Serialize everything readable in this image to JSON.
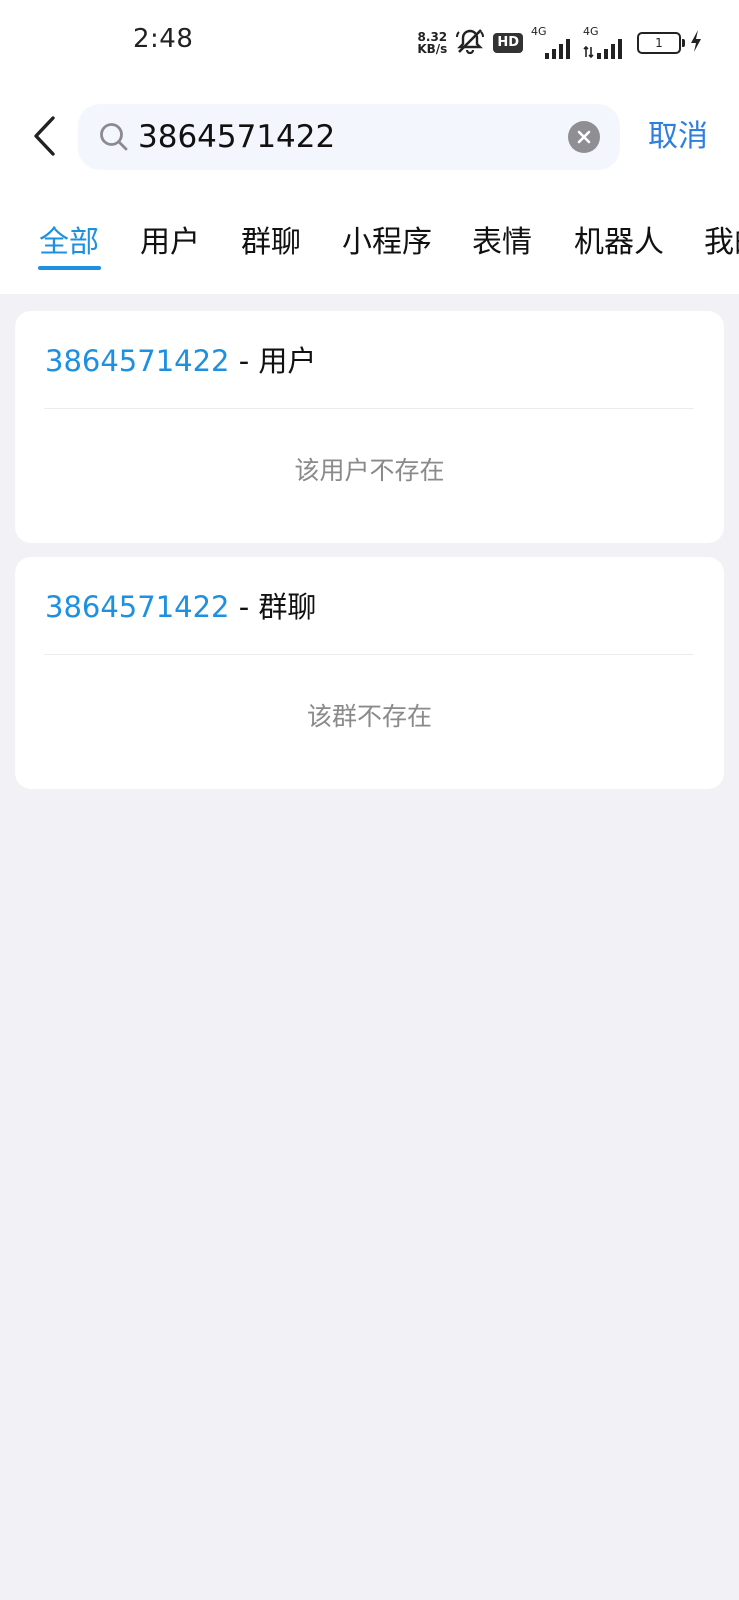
{
  "status_bar": {
    "time": "2:48",
    "net_speed_value": "8.32",
    "net_speed_unit": "KB/s",
    "hd_label": "HD",
    "signal_1_label": "4G",
    "signal_2_label": "4G",
    "battery_level": "1",
    "icons": [
      "mute-icon",
      "signal-icon",
      "signal-icon",
      "battery-icon",
      "charging-icon"
    ]
  },
  "search": {
    "query": "3864571422",
    "cancel_label": "取消"
  },
  "tabs": [
    {
      "label": "全部",
      "active": true
    },
    {
      "label": "用户",
      "active": false
    },
    {
      "label": "群聊",
      "active": false
    },
    {
      "label": "小程序",
      "active": false
    },
    {
      "label": "表情",
      "active": false
    },
    {
      "label": "机器人",
      "active": false
    },
    {
      "label": "我的",
      "active": false
    }
  ],
  "results": [
    {
      "number": "3864571422",
      "type": " - 用户",
      "empty_text": "该用户不存在"
    },
    {
      "number": "3864571422",
      "type": " - 群聊",
      "empty_text": "该群不存在"
    }
  ],
  "colors": {
    "accent": "#1e90e0",
    "cancel": "#2d7fe0",
    "page_bg": "#f1f1f6",
    "muted_text": "#8a8a8a"
  }
}
